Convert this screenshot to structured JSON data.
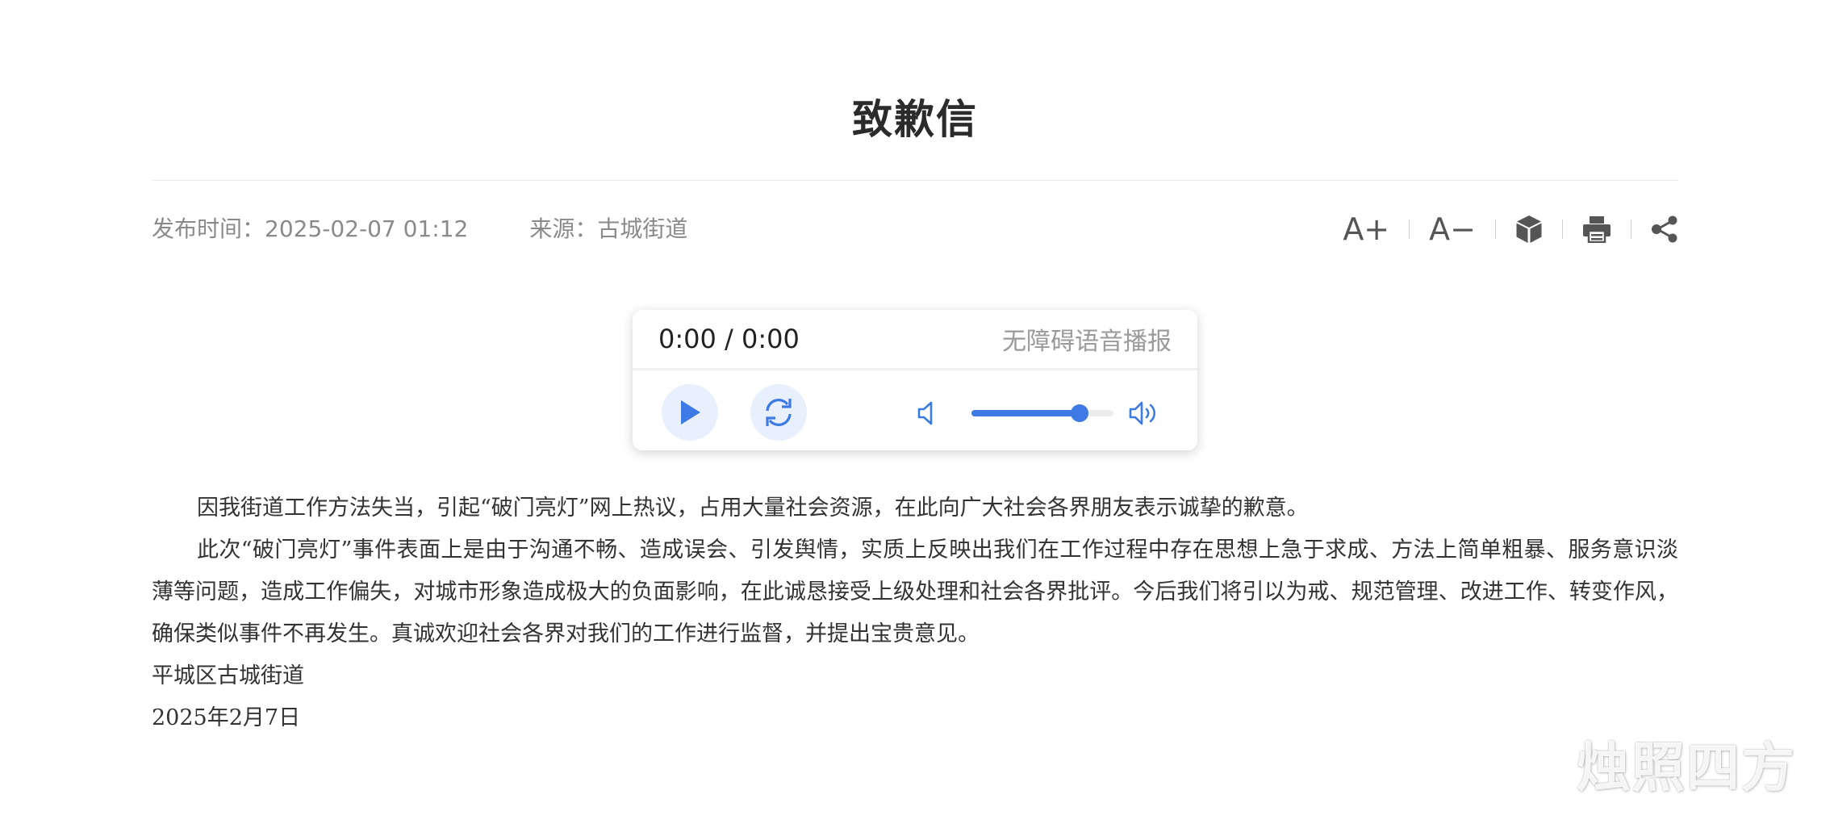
{
  "article": {
    "title": "致歉信",
    "publish_label": "发布时间：",
    "publish_time": "2025-02-07 01:12",
    "source_label": "来源：",
    "source": "古城街道",
    "paragraphs": [
      "因我街道工作方法失当，引起“破门亮灯”网上热议，占用大量社会资源，在此向广大社会各界朋友表示诚挚的歉意。",
      "此次“破门亮灯”事件表面上是由于沟通不畅、造成误会、引发舆情，实质上反映出我们在工作过程中存在思想上急于求成、方法上简单粗暴、服务意识淡薄等问题，造成工作偏失，对城市形象造成极大的负面影响，在此诚恳接受上级处理和社会各界批评。今后我们将引以为戒、规范管理、改进工作、转变作风，确保类似事件不再发生。真诚欢迎社会各界对我们的工作进行监督，并提出宝贵意见。"
    ],
    "signature": "平城区古城街道",
    "date": "2025年2月7日"
  },
  "toolbar": {
    "font_increase_label": "A+",
    "font_decrease_label": "A−",
    "icons": [
      "font-increase-icon",
      "font-decrease-icon",
      "cube-icon",
      "print-icon",
      "share-icon"
    ]
  },
  "player": {
    "time": "0:00 / 0:00",
    "accessibility_label": "无障碍语音播报",
    "volume": 0.76,
    "accent_color": "#3d7ae5"
  },
  "watermark": "烛照四方"
}
